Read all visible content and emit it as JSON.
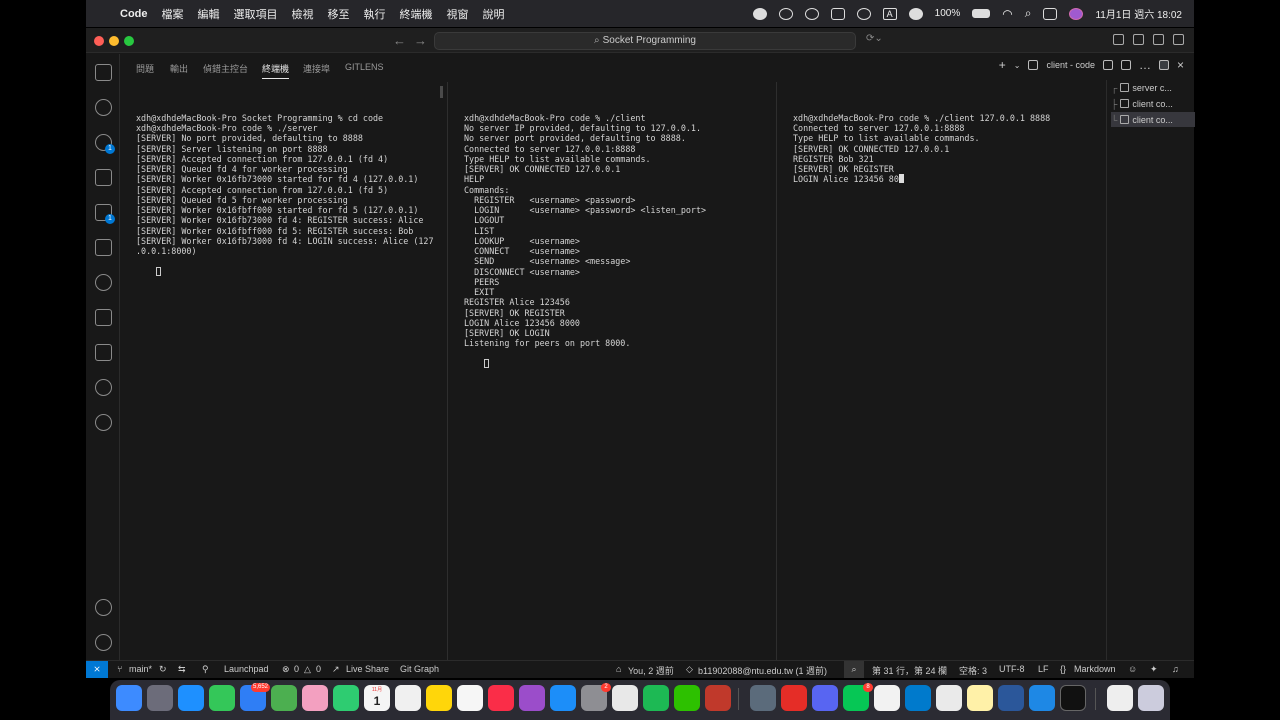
{
  "menubar": {
    "app": "Code",
    "menus": [
      "檔案",
      "編輯",
      "選取項目",
      "檢視",
      "移至",
      "執行",
      "終端機",
      "視窗",
      "說明"
    ],
    "battery": "100%",
    "datetime": "11月1日 週六 18:02",
    "input_method": "A"
  },
  "titlebar": {
    "search": "Socket Programming"
  },
  "activity_bar": {
    "badges": [
      "1",
      "1"
    ]
  },
  "panel": {
    "tabs": [
      "問題",
      "輸出",
      "偵錯主控台",
      "終端機",
      "連接埠",
      "GITLENS"
    ],
    "active_tab": "終端機",
    "current_terminal": "client - code"
  },
  "terminals": {
    "left": [
      "xdh@xdhdeMacBook-Pro Socket Programming % cd code",
      "xdh@xdhdeMacBook-Pro code % ./server",
      "[SERVER] No port provided, defaulting to 8888",
      "[SERVER] Server listening on port 8888",
      "[SERVER] Accepted connection from 127.0.0.1 (fd 4)",
      "[SERVER] Queued fd 4 for worker processing",
      "[SERVER] Worker 0x16fb73000 started for fd 4 (127.0.0.1)",
      "[SERVER] Accepted connection from 127.0.0.1 (fd 5)",
      "[SERVER] Queued fd 5 for worker processing",
      "[SERVER] Worker 0x16fbff000 started for fd 5 (127.0.0.1)",
      "[SERVER] Worker 0x16fb73000 fd 4: REGISTER success: Alice",
      "[SERVER] Worker 0x16fbff000 fd 5: REGISTER success: Bob",
      "[SERVER] Worker 0x16fb73000 fd 4: LOGIN success: Alice (127",
      ".0.0.1:8000)"
    ],
    "middle": [
      "xdh@xdhdeMacBook-Pro code % ./client",
      "No server IP provided, defaulting to 127.0.0.1.",
      "No server port provided, defaulting to 8888.",
      "Connected to server 127.0.0.1:8888",
      "Type HELP to list available commands.",
      "[SERVER] OK CONNECTED 127.0.0.1",
      "HELP",
      "Commands:",
      "  REGISTER   <username> <password>",
      "  LOGIN      <username> <password> <listen_port>",
      "  LOGOUT",
      "  LIST",
      "  LOOKUP     <username>",
      "  CONNECT    <username>",
      "  SEND       <username> <message>",
      "  DISCONNECT <username>",
      "  PEERS",
      "  EXIT",
      "REGISTER Alice 123456",
      "[SERVER] OK REGISTER",
      "LOGIN Alice 123456 8000",
      "[SERVER] OK LOGIN",
      "Listening for peers on port 8000."
    ],
    "right": [
      "xdh@xdhdeMacBook-Pro code % ./client 127.0.0.1 8888",
      "Connected to server 127.0.0.1:8888",
      "Type HELP to list available commands.",
      "[SERVER] OK CONNECTED 127.0.0.1",
      "REGISTER Bob 321",
      "[SERVER] OK REGISTER",
      "LOGIN Alice 123456 80"
    ]
  },
  "terminal_list": [
    "server c...",
    "client co...",
    "client co..."
  ],
  "statusbar": {
    "branch": "main*",
    "launchpad": "Launchpad",
    "errors": "0",
    "warnings": "0",
    "live_share": "Live Share",
    "git_graph": "Git Graph",
    "blame": "You, 2 週前",
    "commit_author": "b11902088@ntu.edu.tw (1 週前)",
    "position": "第 31 行，第 24 欄",
    "spaces": "空格: 3",
    "encoding": "UTF-8",
    "eol": "LF",
    "language": "Markdown"
  },
  "dock": {
    "mail_badge": "5,652",
    "settings_badge": "2",
    "calendar_day": "1",
    "calendar_month": "11月",
    "line_badge": "8"
  },
  "colors": {
    "accent": "#0078d4",
    "terminal_bg": "#181818",
    "text": "#d4d4d4"
  }
}
